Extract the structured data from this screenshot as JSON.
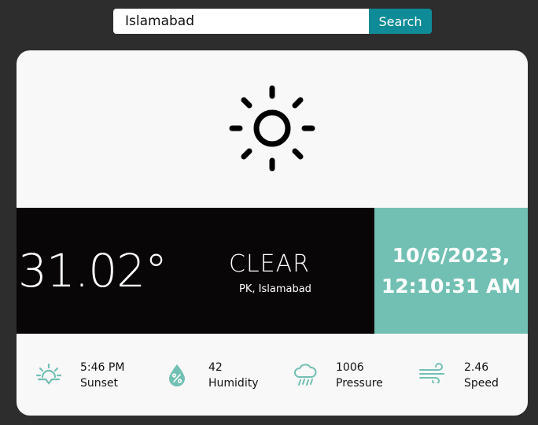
{
  "search": {
    "value": "Islamabad",
    "button_label": "Search"
  },
  "weather": {
    "icon": "sun-icon",
    "temperature": "31.02°",
    "condition": "CLEAR",
    "location": "PK, Islamabad",
    "date": "10/6/2023,",
    "time": "12:10:31 AM"
  },
  "stats": {
    "sunset": {
      "icon": "sunset-icon",
      "value": "5:46 PM",
      "label": "Sunset"
    },
    "humidity": {
      "icon": "humidity-drop-icon",
      "value": "42",
      "label": "Humidity"
    },
    "pressure": {
      "icon": "rain-cloud-icon",
      "value": "1006",
      "label": "Pressure"
    },
    "speed": {
      "icon": "wind-icon",
      "value": "2.46",
      "label": "Speed"
    }
  },
  "colors": {
    "background": "#2d2d2d",
    "accent": "#72c0b3",
    "button": "#0e8b97",
    "dark_band": "#080606",
    "card": "#f8f8f8"
  }
}
